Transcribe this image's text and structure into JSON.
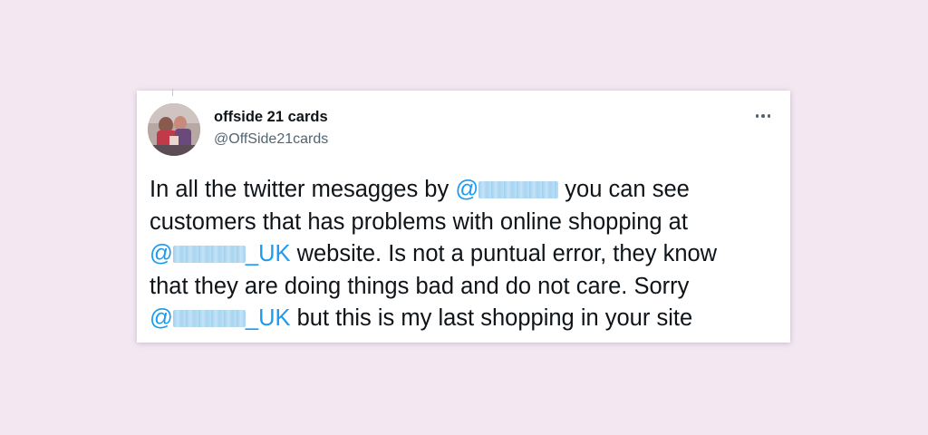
{
  "tweet": {
    "author": {
      "display_name": "offside 21 cards",
      "handle": "@OffSide21cards",
      "avatar_icon": "profile-avatar"
    },
    "more_icon": "more-horizontal-icon",
    "body": {
      "line1": {
        "pre": "In all the twitter mesagges by ",
        "mention_at": "@",
        "post": " you can see"
      },
      "line2": {
        "text": "customers that has problems with online shopping at"
      },
      "line3": {
        "mention_at": "@",
        "mention_suffix": "_UK",
        "post": " website. Is not a puntual error, they know"
      },
      "line4": {
        "text": "that they are doing things bad and do not care. Sorry"
      },
      "line5": {
        "mention_at": "@",
        "mention_suffix": "_UK",
        "post": " but this is my last shopping in your site"
      }
    }
  },
  "colors": {
    "background": "#f3e8f1",
    "card": "#ffffff",
    "text": "#0f1419",
    "secondary": "#536471",
    "mention": "#1d9bf0"
  }
}
